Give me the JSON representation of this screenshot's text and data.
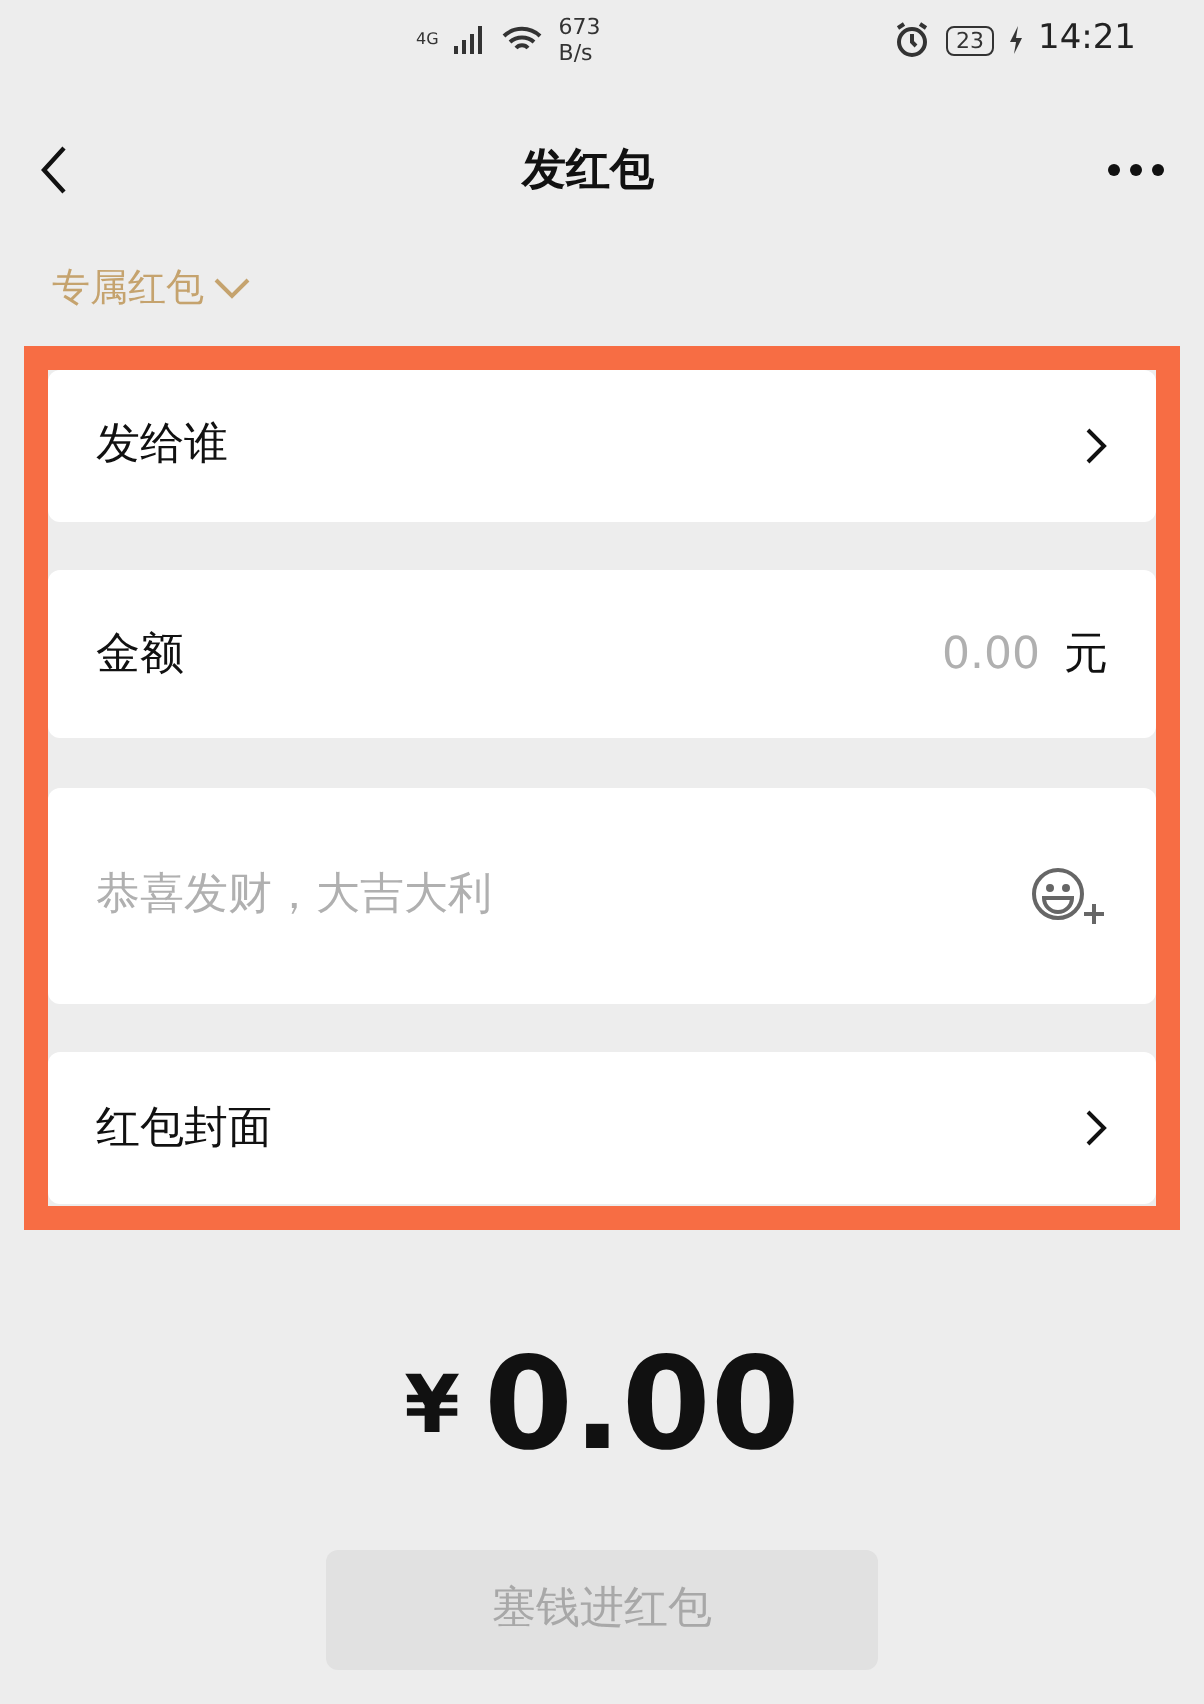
{
  "status_bar": {
    "network": "4G",
    "speed_value": "673",
    "speed_unit": "B/s",
    "battery": "23",
    "time": "14:21"
  },
  "header": {
    "title": "发红包"
  },
  "packet_type": {
    "label": "专属红包"
  },
  "form": [
    {
      "kind": "link",
      "label": "发给谁"
    },
    {
      "kind": "amount",
      "label": "金额",
      "placeholder": "0.00",
      "unit": "元"
    },
    {
      "kind": "message",
      "placeholder": "恭喜发财，大吉大利"
    },
    {
      "kind": "link",
      "label": "红包封面"
    }
  ],
  "total": {
    "currency": "¥",
    "amount": "0.00"
  },
  "submit": {
    "label": "塞钱进红包",
    "disabled": true
  }
}
